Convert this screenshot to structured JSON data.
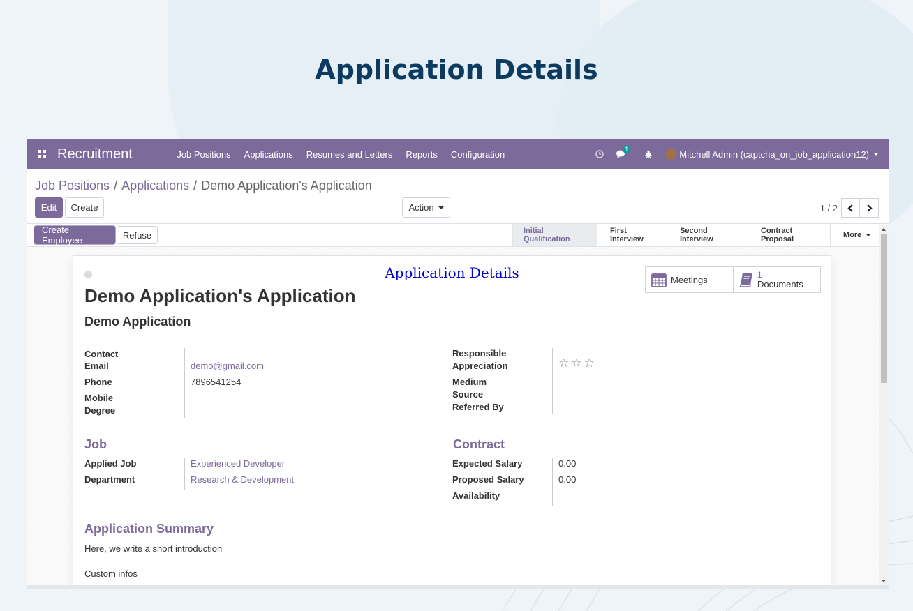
{
  "banner": {
    "title": "Application Details"
  },
  "navbar": {
    "app_name": "Recruitment",
    "menu": [
      "Job Positions",
      "Applications",
      "Resumes and Letters",
      "Reports",
      "Configuration"
    ],
    "chat_count": "1",
    "user": "Mitchell Admin (captcha_on_job_application12)"
  },
  "breadcrumb": {
    "b1": "Job Positions",
    "b2": "Applications",
    "current": "Demo Application's Application"
  },
  "control": {
    "edit": "Edit",
    "create": "Create",
    "action": "Action",
    "pager": "1 / 2"
  },
  "statusbar": {
    "create_employee": "Create Employee",
    "refuse": "Refuse",
    "stages": [
      "Initial Qualification",
      "First Interview",
      "Second Interview",
      "Contract Proposal",
      "More"
    ]
  },
  "sheet": {
    "watermark": "Application  Details",
    "title": "Demo Application's Application",
    "subtitle": "Demo Application",
    "smart": {
      "meetings": "Meetings",
      "documents_count": "1",
      "documents": "Documents"
    },
    "left_fields": {
      "contact": "Contact",
      "email_label": "Email",
      "email": "demo@gmail.com",
      "phone_label": "Phone",
      "phone": "7896541254",
      "mobile_label": "Mobile",
      "degree_label": "Degree"
    },
    "right_fields": {
      "responsible": "Responsible",
      "appreciation": "Appreciation",
      "medium": "Medium",
      "source": "Source",
      "referred_by": "Referred By"
    },
    "job": {
      "title": "Job",
      "applied_job_label": "Applied Job",
      "applied_job": "Experienced Developer",
      "department_label": "Department",
      "department": "Research & Development"
    },
    "contract": {
      "title": "Contract",
      "expected_label": "Expected Salary",
      "expected": "0.00",
      "proposed_label": "Proposed Salary",
      "proposed": "0.00",
      "availability_label": "Availability"
    },
    "summary": {
      "title": "Application Summary",
      "text": "Here, we write a short introduction",
      "custom": "Custom infos"
    }
  },
  "colors": {
    "brand": "#7c6a9b",
    "banner_title": "#0d3b5f"
  }
}
